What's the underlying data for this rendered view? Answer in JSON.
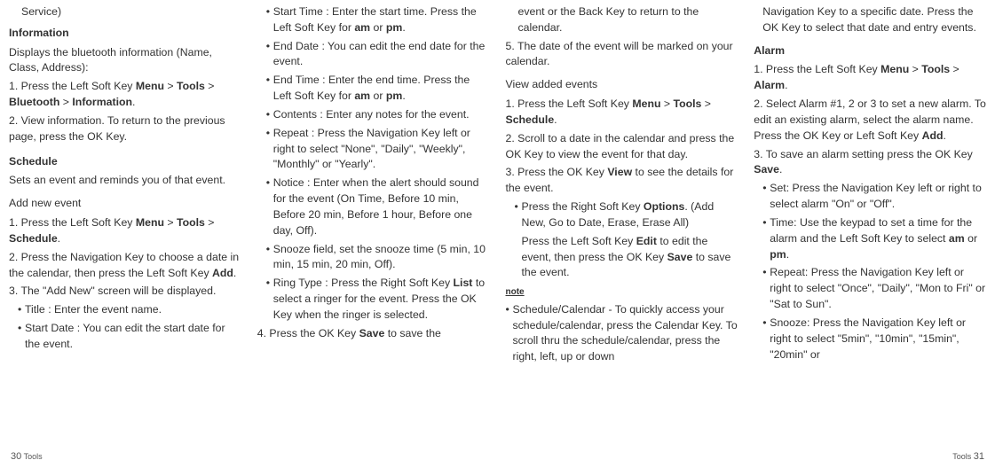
{
  "col1": {
    "service_tail": "Service)",
    "info_h": "Information",
    "info_p": "Displays the bluetooth information (Name, Class, Address):",
    "info_s1a": "1. Press the Left Soft Key ",
    "info_s1b": "Menu",
    "info_s1c": " > ",
    "info_s1d": "Tools",
    "info_s1e": " > ",
    "info_s1f": "Bluetooth",
    "info_s1g": " > ",
    "info_s1h": "Information",
    "info_s1i": ".",
    "info_s2": "2. View information. To return to the previous page, press the OK Key.",
    "sched_h": "Schedule",
    "sched_p": "Sets an event and reminds you of that event.",
    "addnew_h": "Add new event",
    "add_s1a": "1. Press the Left Soft Key ",
    "add_s1b": "Menu",
    "add_s1c": " > ",
    "add_s1d": "Tools",
    "add_s1e": " > ",
    "add_s1f": "Schedule",
    "add_s1g": ".",
    "add_s2a": "2. Press the Navigation Key to choose a date in the calendar, then press the Left Soft Key ",
    "add_s2b": "Add",
    "add_s2c": ".",
    "add_s3": "3. The \"Add New\" screen will be displayed.",
    "add_b1": "Title : Enter the event name.",
    "add_b2": "Start Date : You can edit the start date for the event."
  },
  "col2": {
    "b1a": "Start Time : Enter the start time. Press the Left Soft Key for ",
    "b1b": "am",
    "b1c": " or ",
    "b1d": "pm",
    "b1e": ".",
    "b2": "End Date : You can edit the end date for the event.",
    "b3a": "End Time : Enter the end time. Press the Left Soft Key for ",
    "b3b": "am",
    "b3c": " or ",
    "b3d": "pm",
    "b3e": ".",
    "b4": "Contents : Enter any notes for the event.",
    "b5": "Repeat : Press the Navigation Key left or right to select \"None\", \"Daily\", \"Weekly\", \"Monthly\" or \"Yearly\".",
    "b6": "Notice : Enter when the alert should sound for the event (On Time, Before 10 min, Before 20 min, Before 1 hour, Before one day, Off).",
    "b7": "Snooze field, set the snooze time (5 min, 10 min, 15 min, 20 min, Off).",
    "b8a": "Ring Type : Press the Right Soft Key ",
    "b8b": "List",
    "b8c": " to select a ringer for the event. Press the OK Key when the ringer is selected.",
    "s4a": "4. Press the OK Key ",
    "s4b": "Save",
    "s4c": " to save the"
  },
  "col3": {
    "cont1": "event or the Back Key to return to the calendar.",
    "s5": "5. The date of the event will be marked on your calendar.",
    "view_h": "View added events",
    "v1a": "1. Press the Left Soft Key ",
    "v1b": "Menu",
    "v1c": " > ",
    "v1d": "Tools",
    "v1e": " > ",
    "v1f": "Schedule",
    "v1g": ".",
    "v2": "2. Scroll to a date in the calendar and press the OK Key to view the event for that day.",
    "v3a": "3. Press the OK Key ",
    "v3b": "View",
    "v3c": " to see the details for the event.",
    "v3ba": "Press the Right Soft Key ",
    "v3bb": "Options",
    "v3bc": ". (Add New, Go to Date, Erase, Erase All)",
    "v3pa": "Press the Left Soft Key ",
    "v3pb": "Edit",
    "v3pc": " to edit the event, then press the OK Key ",
    "v3pd": "Save",
    "v3pe": " to save the event.",
    "note_h": "note",
    "n1": "Schedule/Calendar - To quickly access your schedule/calendar, press the Calendar Key. To scroll thru the schedule/calendar, press the right, left, up or down"
  },
  "col4": {
    "cont": "Navigation Key to a specific date. Press the OK Key to select that date and entry events.",
    "alarm_h": "Alarm",
    "a1a": "1. Press the Left Soft Key ",
    "a1b": "Menu",
    "a1c": " > ",
    "a1d": "Tools",
    "a1e": " > ",
    "a1f": "Alarm",
    "a1g": ".",
    "a2a": "2. Select Alarm #1, 2 or 3 to set a new alarm. To edit an existing alarm, select the alarm name. Press the OK Key or Left Soft Key ",
    "a2b": "Add",
    "a2c": ".",
    "a3a": "3. To save an alarm setting press the OK Key ",
    "a3b": "Save",
    "a3c": ".",
    "ab1": "Set: Press the Navigation Key left or right to select alarm \"On\" or \"Off\".",
    "ab2a": "Time: Use the keypad to set a time for the alarm and the Left Soft Key to select ",
    "ab2b": "am",
    "ab2c": " or ",
    "ab2d": "pm",
    "ab2e": ".",
    "ab3": "Repeat: Press the Navigation Key left or right to select \"Once\", \"Daily\", \"Mon to Fri\" or \"Sat to Sun\".",
    "ab4": "Snooze: Press the Navigation Key left or right to select \"5min\", \"10min\", \"15min\", \"20min\" or"
  },
  "footer": {
    "left_pn": "30",
    "left_label": "Tools",
    "right_label": "Tools",
    "right_pn": "31"
  }
}
